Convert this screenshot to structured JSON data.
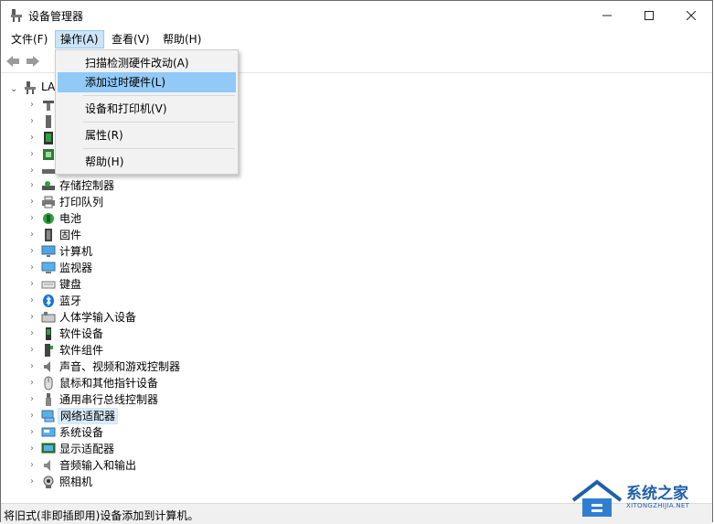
{
  "window": {
    "title": "设备管理器"
  },
  "menubar": {
    "file": "文件(F)",
    "action": "操作(A)",
    "view": "查看(V)",
    "help": "帮助(H)"
  },
  "action_menu": {
    "items": [
      "扫描检测硬件改动(A)",
      "添加过时硬件(L)",
      "设备和打印机(V)",
      "属性(R)",
      "帮助(H)"
    ],
    "highlighted": "添加过时硬件(L)"
  },
  "tree": {
    "root_label": "LA",
    "categories": [
      "存储控制器",
      "打印队列",
      "电池",
      "固件",
      "计算机",
      "监视器",
      "键盘",
      "蓝牙",
      "人体学输入设备",
      "软件设备",
      "软件组件",
      "声音、视频和游戏控制器",
      "鼠标和其他指针设备",
      "通用串行总线控制器",
      "网络适配器",
      "系统设备",
      "显示适配器",
      "音频输入和输出",
      "照相机"
    ],
    "selected": "网络适配器"
  },
  "statusbar": {
    "text": "将旧式(非即插即用)设备添加到计算机。"
  },
  "watermark": {
    "brand": "系统之家",
    "url": "XITONGZHIJIA.NET"
  },
  "colors": {
    "menu_highlight": "#91c9f7",
    "menu_active": "#cce4f7",
    "selection": "#d9ebf9",
    "accent": "#1e5fa8"
  }
}
